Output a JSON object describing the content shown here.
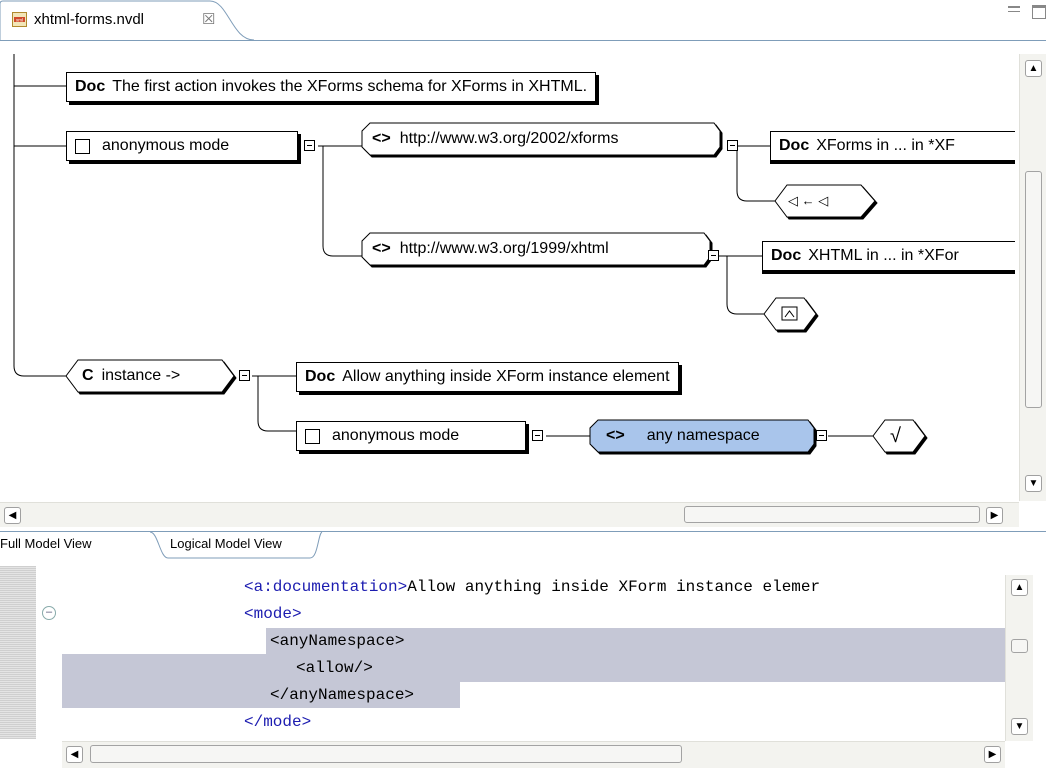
{
  "editor_tab": {
    "filename": "xhtml-forms.nvdl",
    "close_glyph": "☒"
  },
  "diagram": {
    "doc1": {
      "keyword": "Doc",
      "text": "The first action invokes the XForms schema for XForms in XHTML."
    },
    "mode1": {
      "label": "anonymous mode"
    },
    "ns_xforms": {
      "glyph": "<>",
      "uri": "http://www.w3.org/2002/xforms"
    },
    "doc_xforms": {
      "keyword": "Doc",
      "text": "XForms in ... in *XF"
    },
    "attach_glyph": "◁ ← ◁",
    "ns_xhtml": {
      "glyph": "<>",
      "uri": "http://www.w3.org/1999/xhtml"
    },
    "doc_xhtml": {
      "keyword": "Doc",
      "text": "XHTML in ... in *XFor"
    },
    "instance": {
      "glyph": "C",
      "label": "instance ->"
    },
    "doc_instance": {
      "keyword": "Doc",
      "text": "Allow anything inside XForm instance element"
    },
    "mode2": {
      "label": "anonymous mode"
    },
    "any_ns": {
      "glyph": "<>",
      "label": "any namespace"
    },
    "allow_glyph": "√"
  },
  "view_tabs": [
    "Full Model View",
    "Logical Model View"
  ],
  "source": {
    "lines": [
      {
        "tag": "<a:documentation>",
        "text": "Allow anything inside XForm instance elemer"
      },
      {
        "tag": "<mode>",
        "text": ""
      },
      {
        "tag": "<anyNamespace>",
        "text": ""
      },
      {
        "tag": "<allow/>",
        "text": ""
      },
      {
        "tag": "</anyNamespace>",
        "text": ""
      },
      {
        "tag": "</mode>",
        "text": ""
      }
    ]
  },
  "colors": {
    "selected_node": "#a9c5eb",
    "highlight": "#c5c7d6",
    "tag_color": "#1c1cb0"
  }
}
